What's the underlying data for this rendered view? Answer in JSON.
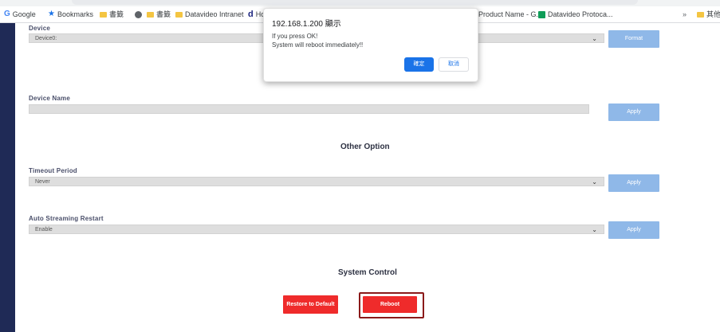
{
  "bookmarks": {
    "google": "Google",
    "bookmarks": "Bookmarks",
    "folder1": "書籤",
    "folder2": "書籤",
    "intranet": "Datavideo Intranet",
    "ho": "Ho",
    "product_name": "Product Name - G...",
    "protocol": "Datavideo Protoca...",
    "overflow": "»",
    "other": "其他"
  },
  "device": {
    "label": "Device",
    "value": "Device0:",
    "button": "Format"
  },
  "device_name": {
    "label": "Device Name",
    "value": "",
    "button": "Apply"
  },
  "other_option": {
    "title": "Other Option",
    "timeout": {
      "label": "Timeout Period",
      "value": "Never",
      "button": "Apply"
    },
    "streaming": {
      "label": "Auto Streaming Restart",
      "value": "Enable",
      "button": "Apply"
    }
  },
  "system_control": {
    "title": "System Control",
    "restore": "Restore to Default",
    "reboot": "Reboot"
  },
  "dialog": {
    "title": "192.168.1.200 顯示",
    "line1": "If you press OK!",
    "line2": "System will reboot immediately!!",
    "ok": "確定",
    "cancel": "取消"
  },
  "colors": {
    "sidebar": "#1f2a56",
    "apply_button": "#8fb8e8",
    "reboot_button": "#ef2b2b",
    "dialog_ok": "#1a73e8"
  }
}
